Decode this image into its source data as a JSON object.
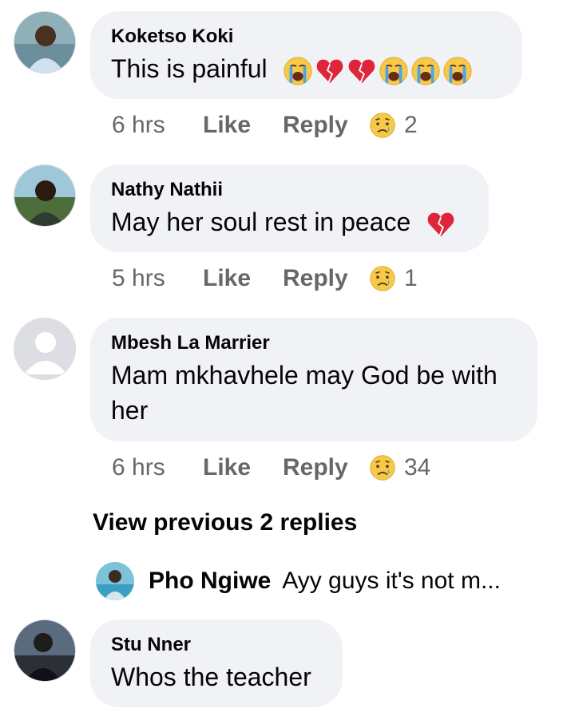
{
  "comments": [
    {
      "author": "Koketso Koki",
      "text": "This is painful",
      "emojis": [
        "crying-face-icon",
        "broken-heart-icon",
        "broken-heart-icon",
        "crying-face-icon",
        "crying-face-icon",
        "crying-face-icon"
      ],
      "time": "6 hrs",
      "like": "Like",
      "reply": "Reply",
      "reaction_count": "2"
    },
    {
      "author": "Nathy Nathii",
      "text": "May her soul rest in peace",
      "emojis": [
        "broken-heart-icon"
      ],
      "time": "5 hrs",
      "like": "Like",
      "reply": "Reply",
      "reaction_count": "1"
    },
    {
      "author": "Mbesh La Marrier",
      "text_line1": "Mam mkhavhele may God be with",
      "text_line2": "her",
      "time": "6 hrs",
      "like": "Like",
      "reply": "Reply",
      "reaction_count": "34"
    },
    {
      "author": "Stu Nner",
      "text": "Whos the teacher"
    }
  ],
  "view_previous": "View previous 2 replies",
  "reply_preview": {
    "author": "Pho Ngiwe",
    "text": "Ayy guys it's not m..."
  },
  "colors": {
    "bubble": "#f0f2f5",
    "meta": "#65676b",
    "text": "#050505",
    "crying_yellow": "#f7c948",
    "broken_heart": "#e0243c"
  }
}
